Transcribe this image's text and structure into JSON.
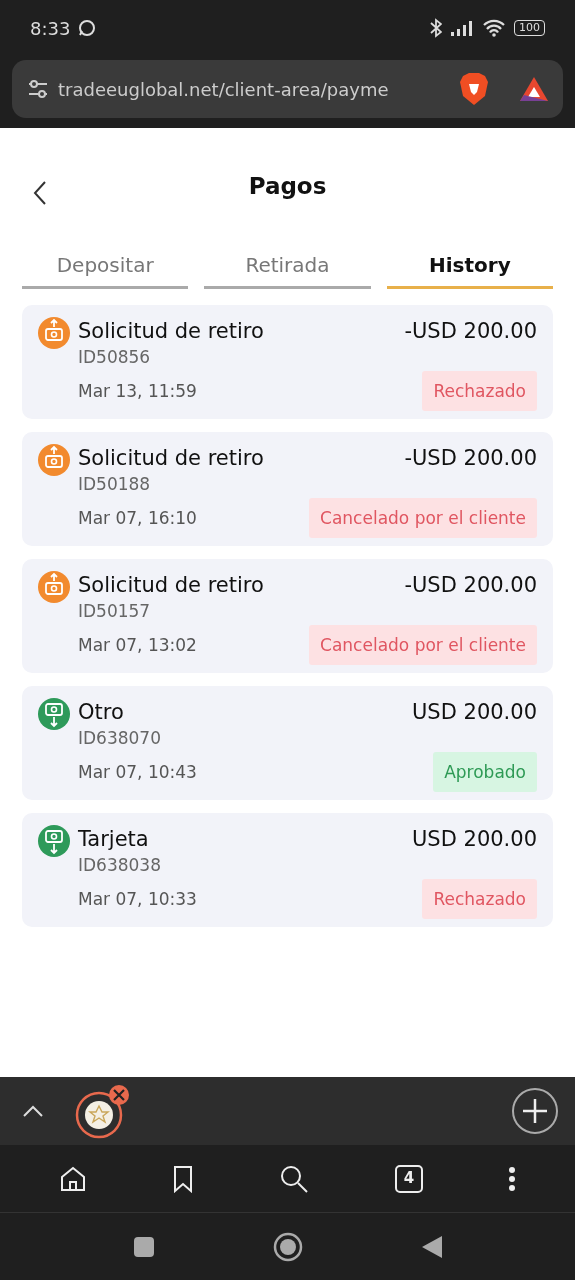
{
  "status_bar": {
    "time": "8:33",
    "battery": "100"
  },
  "address_bar": {
    "url": "tradeeuglobal.net/client-area/payme"
  },
  "header": {
    "title": "Pagos"
  },
  "tabs": [
    {
      "label": "Depositar",
      "selected": false
    },
    {
      "label": "Retirada",
      "selected": false
    },
    {
      "label": "History",
      "selected": true
    }
  ],
  "transactions": [
    {
      "kind": "withdrawal",
      "title": "Solicitud de retiro",
      "id": "ID50856",
      "date": "Mar 13, 11:59",
      "amount": "-USD 200.00",
      "status": {
        "label": "Rechazado",
        "kind": "rejected"
      }
    },
    {
      "kind": "withdrawal",
      "title": "Solicitud de retiro",
      "id": "ID50188",
      "date": "Mar 07, 16:10",
      "amount": "-USD 200.00",
      "status": {
        "label": "Cancelado por el cliente",
        "kind": "rejected"
      }
    },
    {
      "kind": "withdrawal",
      "title": "Solicitud de retiro",
      "id": "ID50157",
      "date": "Mar 07, 13:02",
      "amount": "-USD 200.00",
      "status": {
        "label": "Cancelado por el cliente",
        "kind": "rejected"
      }
    },
    {
      "kind": "deposit",
      "title": "Otro",
      "id": "ID638070",
      "date": "Mar 07, 10:43",
      "amount": "USD 200.00",
      "status": {
        "label": "Aprobado",
        "kind": "approved"
      }
    },
    {
      "kind": "deposit",
      "title": "Tarjeta",
      "id": "ID638038",
      "date": "Mar 07, 10:33",
      "amount": "USD 200.00",
      "status": {
        "label": "Rechazado",
        "kind": "rejected"
      }
    }
  ],
  "bottom_bar": {
    "tab_count": "4"
  }
}
